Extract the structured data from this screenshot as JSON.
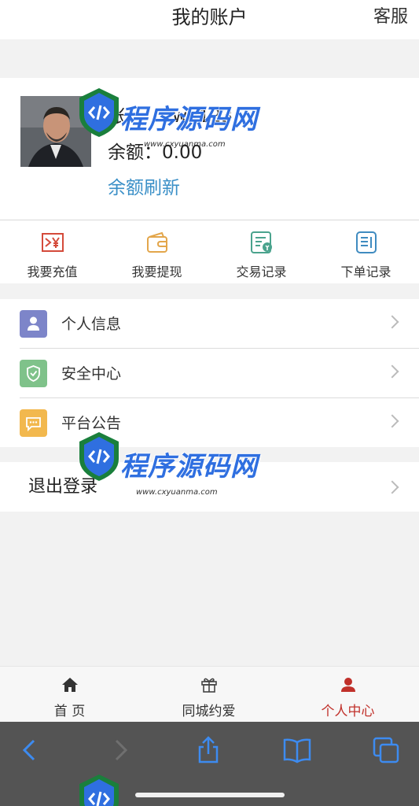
{
  "header": {
    "title": "我的账户",
    "service_label": "客服"
  },
  "profile": {
    "username_prefix": "账",
    "username": "qwe123",
    "balance_text": "余额：0.00",
    "refresh_label": "余额刷新"
  },
  "actions": [
    {
      "label": "我要充值",
      "icon": "yen-transfer-icon",
      "color": "#d44a3a"
    },
    {
      "label": "我要提现",
      "icon": "wallet-icon",
      "color": "#e3a64b"
    },
    {
      "label": "交易记录",
      "icon": "transaction-record-icon",
      "color": "#4aa38d"
    },
    {
      "label": "下单记录",
      "icon": "order-record-icon",
      "color": "#3f8bc0"
    }
  ],
  "menu": [
    {
      "label": "个人信息",
      "icon": "person-icon",
      "color": "#7d85c9"
    },
    {
      "label": "安全中心",
      "icon": "shield-check-icon",
      "color": "#7fc28a"
    },
    {
      "label": "平台公告",
      "icon": "message-icon",
      "color": "#f2b84e"
    }
  ],
  "logout_label": "退出登录",
  "tabs": [
    {
      "label": "首 页",
      "icon": "home-icon",
      "active": false
    },
    {
      "label": "同城约爱",
      "icon": "gift-icon",
      "active": false
    },
    {
      "label": "个人中心",
      "icon": "user-icon",
      "active": true
    }
  ],
  "browser_toolbar": {
    "icons": [
      "back-icon",
      "forward-icon",
      "share-icon",
      "bookmarks-icon",
      "tabs-icon"
    ],
    "accent": "#3d8bf0"
  },
  "watermark": {
    "text": "程序源码网",
    "url": "www.cxyuanma.com"
  }
}
